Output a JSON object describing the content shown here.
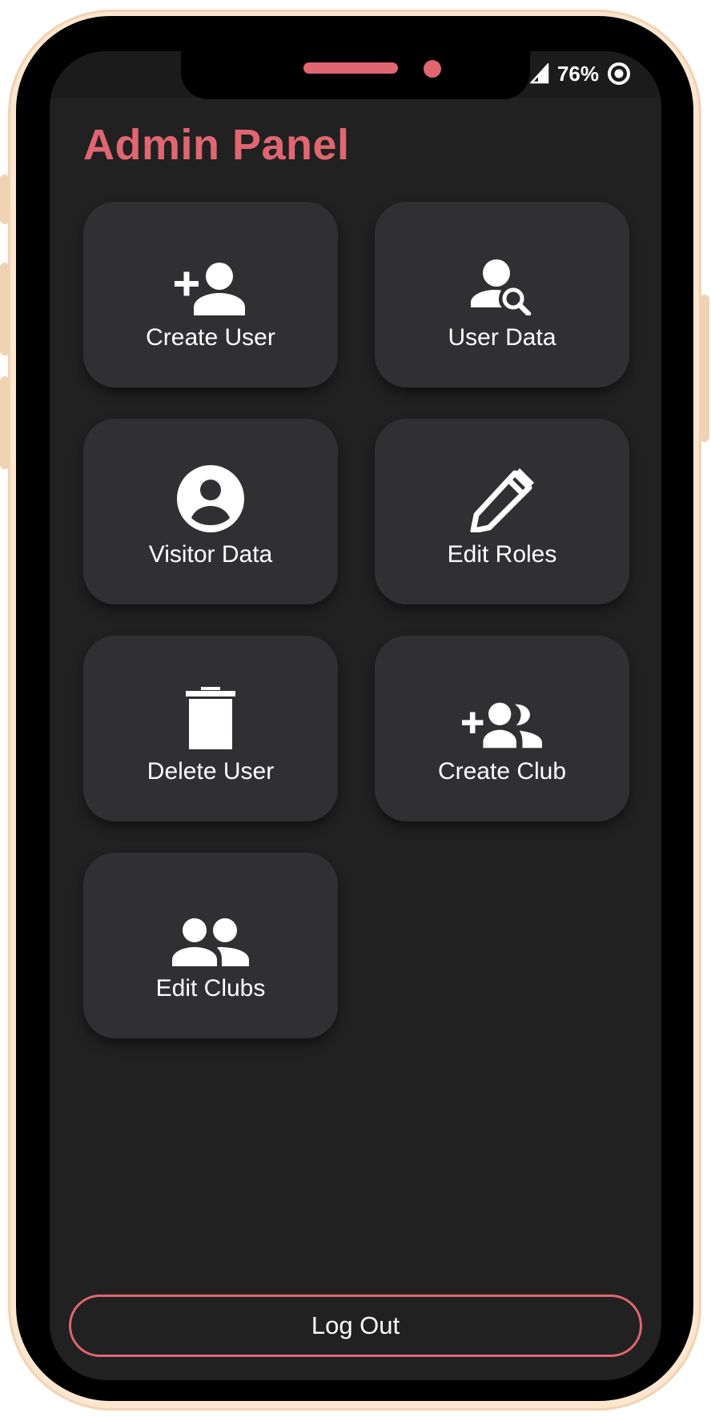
{
  "status_bar": {
    "battery": "76%",
    "icons": [
      "signal-icon",
      "battery-saver-icon"
    ]
  },
  "header": {
    "title": "Admin Panel"
  },
  "tiles": [
    {
      "label": "Create User",
      "icon": "add-user-icon"
    },
    {
      "label": "User Data",
      "icon": "user-search-icon"
    },
    {
      "label": "Visitor Data",
      "icon": "account-circle-icon"
    },
    {
      "label": "Edit Roles",
      "icon": "pencil-icon"
    },
    {
      "label": "Delete User",
      "icon": "trash-icon"
    },
    {
      "label": "Create Club",
      "icon": "add-group-icon"
    },
    {
      "label": "Edit Clubs",
      "icon": "group-icon"
    }
  ],
  "footer": {
    "logout_label": "Log Out"
  },
  "colors": {
    "accent": "#e06672",
    "screen_background": "#212121",
    "tile_background": "#303032",
    "text": "#ffffff",
    "frame": "#fde6d0"
  }
}
